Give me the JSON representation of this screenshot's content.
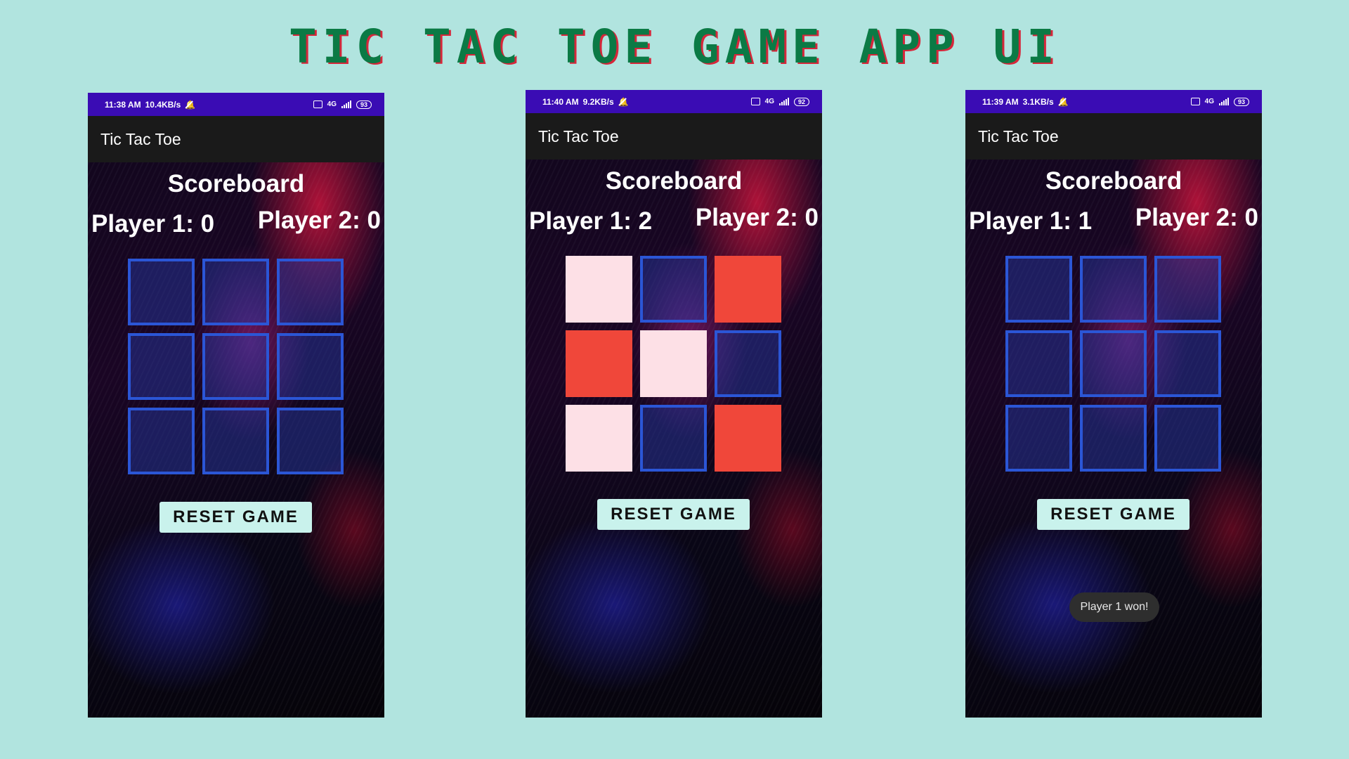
{
  "title": "TIC TAC TOE GAME APP UI",
  "colors": {
    "background": "#b1e4df",
    "title_green": "#0b7a45",
    "title_shadow": "#d6263a",
    "status_bar": "#3a0cb4",
    "app_bar": "#1a1a1a",
    "cell_empty_border": "#2b56d6",
    "player1_mark": "#fde0e6",
    "player2_mark": "#f0473a",
    "reset_button": "#c9f2ec"
  },
  "screens": [
    {
      "status": {
        "time": "11:38 AM",
        "speed": "10.4KB/s",
        "network": "4G",
        "battery": "93"
      },
      "app_title": "Tic Tac Toe",
      "scoreboard_title": "Scoreboard",
      "player1_score": "Player 1: 0",
      "player2_score": "Player 2: 0",
      "board": [
        "",
        "",
        "",
        "",
        "",
        "",
        "",
        "",
        ""
      ],
      "reset_label": "RESET GAME",
      "toast": ""
    },
    {
      "status": {
        "time": "11:40 AM",
        "speed": "9.2KB/s",
        "network": "4G",
        "battery": "92"
      },
      "app_title": "Tic Tac Toe",
      "scoreboard_title": "Scoreboard",
      "player1_score": "Player 1: 2",
      "player2_score": "Player 2: 0",
      "board": [
        "p1",
        "",
        "p2",
        "p2",
        "p1",
        "",
        "p1",
        "",
        "p2"
      ],
      "reset_label": "RESET GAME",
      "toast": ""
    },
    {
      "status": {
        "time": "11:39 AM",
        "speed": "3.1KB/s",
        "network": "4G",
        "battery": "93"
      },
      "app_title": "Tic Tac Toe",
      "scoreboard_title": "Scoreboard",
      "player1_score": "Player 1: 1",
      "player2_score": "Player 2: 0",
      "board": [
        "",
        "",
        "",
        "",
        "",
        "",
        "",
        "",
        ""
      ],
      "reset_label": "RESET GAME",
      "toast": "Player 1 won!"
    }
  ]
}
